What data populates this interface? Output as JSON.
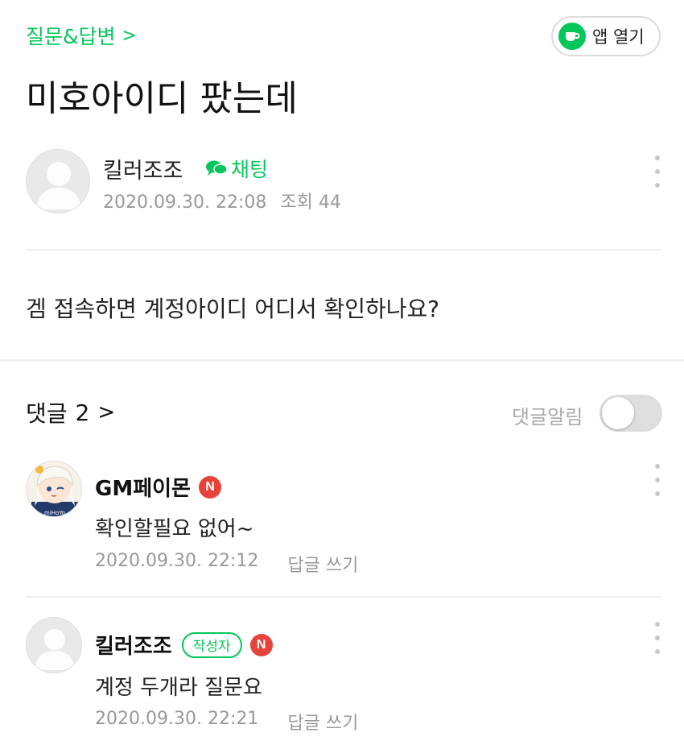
{
  "header": {
    "board_link": "질문&답변",
    "open_app_label": "앱 열기"
  },
  "post": {
    "title": "미호아이디 팠는데",
    "author": "킬러조조",
    "chat_label": "채팅",
    "date": "2020.09.30. 22:08",
    "views": "조회 44",
    "body": "겜 접속하면 계정아이디 어디서 확인하나요?"
  },
  "comments_section": {
    "title": "댓글",
    "count": "2",
    "notify_label": "댓글알림",
    "notify_on": false
  },
  "comments": [
    {
      "name": "GM페이몬",
      "badge": "N",
      "text": "확인할필요 없어~",
      "date": "2020.09.30. 22:12",
      "reply_label": "답글 쓰기"
    },
    {
      "name": "킬러조조",
      "author_badge": "작성자",
      "badge": "N",
      "text": "계정 두개라 질문요",
      "date": "2020.09.30. 22:21",
      "reply_label": "답글 쓰기"
    }
  ],
  "colors": {
    "accent": "#03c75a",
    "new_badge": "#e8433b",
    "meta_text": "#999999"
  },
  "icons": [
    "chevron-right-icon",
    "cafe-cup-icon",
    "default-avatar-icon",
    "chat-bubble-icon",
    "more-vertical-icon"
  ]
}
